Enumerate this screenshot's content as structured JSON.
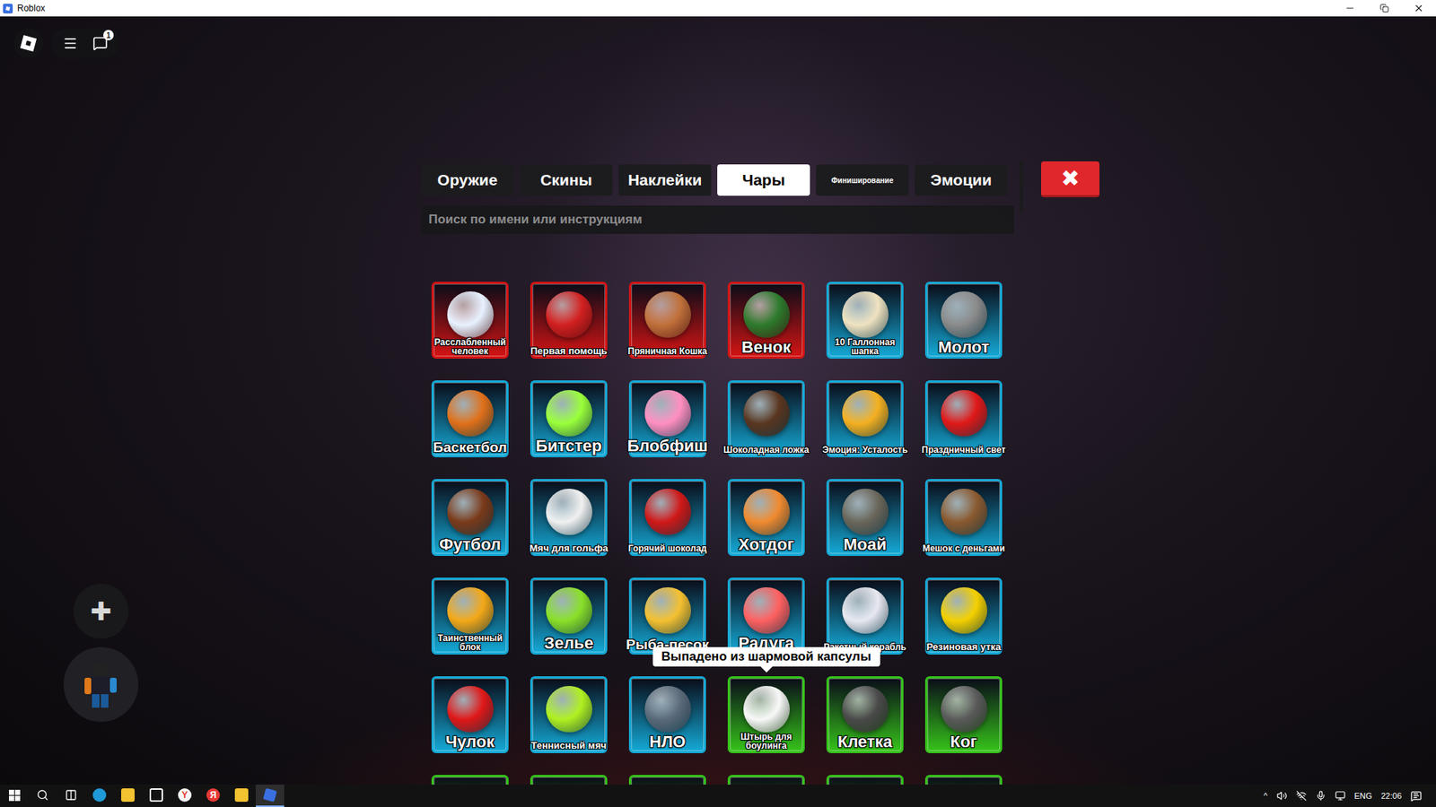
{
  "window": {
    "title": "Roblox"
  },
  "hud": {
    "chat_badge": "1",
    "plus": "✚"
  },
  "inventory": {
    "tabs": [
      {
        "label": "Оружие",
        "selected": false
      },
      {
        "label": "Скины",
        "selected": false
      },
      {
        "label": "Наклейки",
        "selected": false
      },
      {
        "label": "Чары",
        "selected": true
      },
      {
        "label": "Финиширование",
        "selected": false
      },
      {
        "label": "Эмоции",
        "selected": false
      }
    ],
    "close": "✖",
    "search": {
      "placeholder": "Поиск по имени или инструкциям"
    },
    "items": [
      {
        "name": "Расслабленный человек",
        "color": "#d41414"
      },
      {
        "name": "Первая помощь",
        "color": "#d41414"
      },
      {
        "name": "Пряничная Кошка",
        "color": "#d41414"
      },
      {
        "name": "Венок",
        "color": "#d41414"
      },
      {
        "name": "10 Галлонная шапка",
        "color": "#14a9d6"
      },
      {
        "name": "Молот",
        "color": "#14a9d6"
      },
      {
        "name": "Баскетбол",
        "color": "#14a9d6"
      },
      {
        "name": "Битстер",
        "color": "#14a9d6"
      },
      {
        "name": "Блобфиш",
        "color": "#14a9d6"
      },
      {
        "name": "Шоколадная ложка",
        "color": "#14a9d6"
      },
      {
        "name": "Эмоция: Усталость",
        "color": "#14a9d6"
      },
      {
        "name": "Праздничный свет",
        "color": "#14a9d6"
      },
      {
        "name": "Футбол",
        "color": "#14a9d6"
      },
      {
        "name": "Мяч для гольфа",
        "color": "#14a9d6"
      },
      {
        "name": "Горячий шоколад",
        "color": "#14a9d6"
      },
      {
        "name": "Хотдог",
        "color": "#14a9d6"
      },
      {
        "name": "Моай",
        "color": "#14a9d6"
      },
      {
        "name": "Мешок с деньгами",
        "color": "#14a9d6"
      },
      {
        "name": "Таинственный блок",
        "color": "#14a9d6"
      },
      {
        "name": "Зелье",
        "color": "#14a9d6"
      },
      {
        "name": "Рыба-песок",
        "color": "#14a9d6"
      },
      {
        "name": "Радуга",
        "color": "#14a9d6"
      },
      {
        "name": "Ракетный корабль",
        "color": "#14a9d6"
      },
      {
        "name": "Резиновая утка",
        "color": "#14a9d6"
      },
      {
        "name": "Чулок",
        "color": "#14a9d6"
      },
      {
        "name": "Теннисный мяч",
        "color": "#14a9d6"
      },
      {
        "name": "НЛО",
        "color": "#14a9d6"
      },
      {
        "name": "Штырь для боулинга",
        "color": "#35c21a"
      },
      {
        "name": "Клетка",
        "color": "#35c21a"
      },
      {
        "name": "Ког",
        "color": "#35c21a"
      },
      {
        "name": "",
        "color": "#35c21a"
      },
      {
        "name": "",
        "color": "#35c21a"
      },
      {
        "name": "",
        "color": "#35c21a"
      },
      {
        "name": "",
        "color": "#35c21a"
      },
      {
        "name": "",
        "color": "#35c21a"
      },
      {
        "name": "",
        "color": "#35c21a"
      }
    ],
    "tooltip": {
      "text": "Выпадено из шармовой капсулы",
      "item": "Штырь для боулинга"
    }
  },
  "taskbar": {
    "apps": [
      {
        "kind": "edge",
        "label": "",
        "color": "#1f9ad6",
        "active": false
      },
      {
        "kind": "explorer",
        "label": "",
        "color": "#f2c230",
        "active": false
      },
      {
        "kind": "store",
        "label": "",
        "color": "#ffffff",
        "active": false
      },
      {
        "kind": "letter",
        "label": "Y",
        "color": "#f5f5f5",
        "active": false
      },
      {
        "kind": "letter",
        "label": "Я",
        "color": "#e53935",
        "active": false
      },
      {
        "kind": "bars",
        "label": "",
        "color": "#f2c230",
        "active": false
      },
      {
        "kind": "roblox",
        "label": "",
        "color": "#3a6fe0",
        "active": true
      }
    ],
    "tray_caret": "^",
    "language": "ENG",
    "time": "22:06"
  }
}
